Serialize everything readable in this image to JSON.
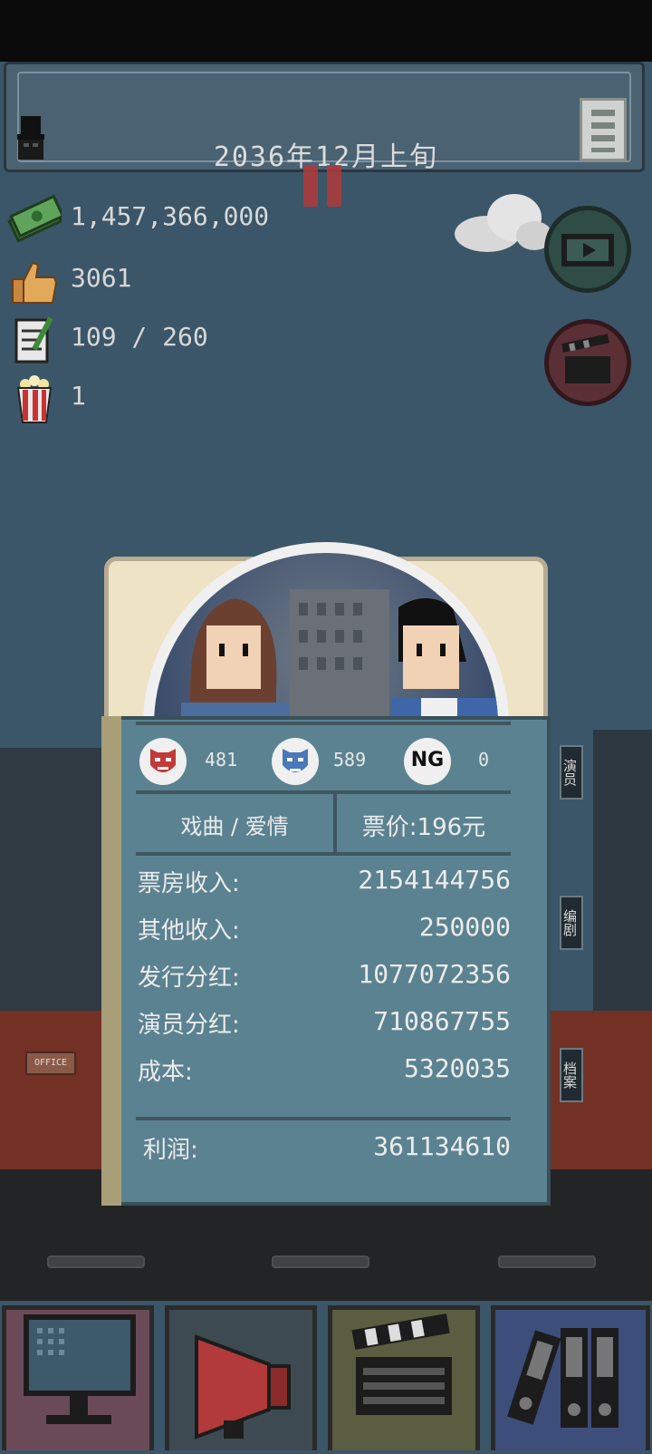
{
  "header": {
    "date": "2036年12月上旬"
  },
  "resources": {
    "money": "1,457,366,000",
    "likes": "3061",
    "scripts": "109 / 260",
    "popcorn": "1"
  },
  "side_tabs": {
    "actors": "演员",
    "writers": "编剧",
    "archive": "档案"
  },
  "street": {
    "office_sign": "OFFICE"
  },
  "result": {
    "reviews": {
      "bad": "481",
      "good": "589",
      "ng_label": "NG",
      "ng": "0"
    },
    "genre": "戏曲 / 爱情",
    "ticket_price": "票价:196元",
    "rows": [
      {
        "label": "票房收入:",
        "value": "2154144756"
      },
      {
        "label": "其他收入:",
        "value": "250000"
      },
      {
        "label": "发行分红:",
        "value": "1077072356"
      },
      {
        "label": "演员分红:",
        "value": "710867755"
      },
      {
        "label": "成本:",
        "value": "5320035"
      }
    ],
    "profit_label": "利润:",
    "profit_value": "361134610"
  },
  "colors": {
    "sky": "#3b5668",
    "panel": "#5b8291",
    "brick": "#733025"
  }
}
